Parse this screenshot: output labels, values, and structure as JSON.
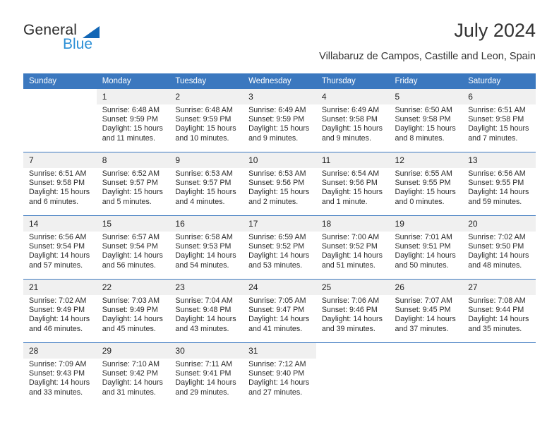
{
  "branding": {
    "name_part1": "General",
    "name_part2": "Blue",
    "triangle_color": "#1266b5",
    "blue_text_color": "#2b8fd6"
  },
  "header": {
    "title": "July 2024",
    "subtitle": "Villabaruz de Campos, Castille and Leon, Spain"
  },
  "theme": {
    "header_blue": "#3b78bf",
    "daynum_background": "#f0f0f0",
    "text_color": "#2a2a2a"
  },
  "columns": [
    "Sunday",
    "Monday",
    "Tuesday",
    "Wednesday",
    "Thursday",
    "Friday",
    "Saturday"
  ],
  "weeks": [
    [
      {
        "day": "",
        "sunrise": "",
        "sunset": "",
        "daylight_line1": "",
        "daylight_line2": ""
      },
      {
        "day": "1",
        "sunrise": "Sunrise: 6:48 AM",
        "sunset": "Sunset: 9:59 PM",
        "daylight_line1": "Daylight: 15 hours",
        "daylight_line2": "and 11 minutes."
      },
      {
        "day": "2",
        "sunrise": "Sunrise: 6:48 AM",
        "sunset": "Sunset: 9:59 PM",
        "daylight_line1": "Daylight: 15 hours",
        "daylight_line2": "and 10 minutes."
      },
      {
        "day": "3",
        "sunrise": "Sunrise: 6:49 AM",
        "sunset": "Sunset: 9:59 PM",
        "daylight_line1": "Daylight: 15 hours",
        "daylight_line2": "and 9 minutes."
      },
      {
        "day": "4",
        "sunrise": "Sunrise: 6:49 AM",
        "sunset": "Sunset: 9:58 PM",
        "daylight_line1": "Daylight: 15 hours",
        "daylight_line2": "and 9 minutes."
      },
      {
        "day": "5",
        "sunrise": "Sunrise: 6:50 AM",
        "sunset": "Sunset: 9:58 PM",
        "daylight_line1": "Daylight: 15 hours",
        "daylight_line2": "and 8 minutes."
      },
      {
        "day": "6",
        "sunrise": "Sunrise: 6:51 AM",
        "sunset": "Sunset: 9:58 PM",
        "daylight_line1": "Daylight: 15 hours",
        "daylight_line2": "and 7 minutes."
      }
    ],
    [
      {
        "day": "7",
        "sunrise": "Sunrise: 6:51 AM",
        "sunset": "Sunset: 9:58 PM",
        "daylight_line1": "Daylight: 15 hours",
        "daylight_line2": "and 6 minutes."
      },
      {
        "day": "8",
        "sunrise": "Sunrise: 6:52 AM",
        "sunset": "Sunset: 9:57 PM",
        "daylight_line1": "Daylight: 15 hours",
        "daylight_line2": "and 5 minutes."
      },
      {
        "day": "9",
        "sunrise": "Sunrise: 6:53 AM",
        "sunset": "Sunset: 9:57 PM",
        "daylight_line1": "Daylight: 15 hours",
        "daylight_line2": "and 4 minutes."
      },
      {
        "day": "10",
        "sunrise": "Sunrise: 6:53 AM",
        "sunset": "Sunset: 9:56 PM",
        "daylight_line1": "Daylight: 15 hours",
        "daylight_line2": "and 2 minutes."
      },
      {
        "day": "11",
        "sunrise": "Sunrise: 6:54 AM",
        "sunset": "Sunset: 9:56 PM",
        "daylight_line1": "Daylight: 15 hours",
        "daylight_line2": "and 1 minute."
      },
      {
        "day": "12",
        "sunrise": "Sunrise: 6:55 AM",
        "sunset": "Sunset: 9:55 PM",
        "daylight_line1": "Daylight: 15 hours",
        "daylight_line2": "and 0 minutes."
      },
      {
        "day": "13",
        "sunrise": "Sunrise: 6:56 AM",
        "sunset": "Sunset: 9:55 PM",
        "daylight_line1": "Daylight: 14 hours",
        "daylight_line2": "and 59 minutes."
      }
    ],
    [
      {
        "day": "14",
        "sunrise": "Sunrise: 6:56 AM",
        "sunset": "Sunset: 9:54 PM",
        "daylight_line1": "Daylight: 14 hours",
        "daylight_line2": "and 57 minutes."
      },
      {
        "day": "15",
        "sunrise": "Sunrise: 6:57 AM",
        "sunset": "Sunset: 9:54 PM",
        "daylight_line1": "Daylight: 14 hours",
        "daylight_line2": "and 56 minutes."
      },
      {
        "day": "16",
        "sunrise": "Sunrise: 6:58 AM",
        "sunset": "Sunset: 9:53 PM",
        "daylight_line1": "Daylight: 14 hours",
        "daylight_line2": "and 54 minutes."
      },
      {
        "day": "17",
        "sunrise": "Sunrise: 6:59 AM",
        "sunset": "Sunset: 9:52 PM",
        "daylight_line1": "Daylight: 14 hours",
        "daylight_line2": "and 53 minutes."
      },
      {
        "day": "18",
        "sunrise": "Sunrise: 7:00 AM",
        "sunset": "Sunset: 9:52 PM",
        "daylight_line1": "Daylight: 14 hours",
        "daylight_line2": "and 51 minutes."
      },
      {
        "day": "19",
        "sunrise": "Sunrise: 7:01 AM",
        "sunset": "Sunset: 9:51 PM",
        "daylight_line1": "Daylight: 14 hours",
        "daylight_line2": "and 50 minutes."
      },
      {
        "day": "20",
        "sunrise": "Sunrise: 7:02 AM",
        "sunset": "Sunset: 9:50 PM",
        "daylight_line1": "Daylight: 14 hours",
        "daylight_line2": "and 48 minutes."
      }
    ],
    [
      {
        "day": "21",
        "sunrise": "Sunrise: 7:02 AM",
        "sunset": "Sunset: 9:49 PM",
        "daylight_line1": "Daylight: 14 hours",
        "daylight_line2": "and 46 minutes."
      },
      {
        "day": "22",
        "sunrise": "Sunrise: 7:03 AM",
        "sunset": "Sunset: 9:49 PM",
        "daylight_line1": "Daylight: 14 hours",
        "daylight_line2": "and 45 minutes."
      },
      {
        "day": "23",
        "sunrise": "Sunrise: 7:04 AM",
        "sunset": "Sunset: 9:48 PM",
        "daylight_line1": "Daylight: 14 hours",
        "daylight_line2": "and 43 minutes."
      },
      {
        "day": "24",
        "sunrise": "Sunrise: 7:05 AM",
        "sunset": "Sunset: 9:47 PM",
        "daylight_line1": "Daylight: 14 hours",
        "daylight_line2": "and 41 minutes."
      },
      {
        "day": "25",
        "sunrise": "Sunrise: 7:06 AM",
        "sunset": "Sunset: 9:46 PM",
        "daylight_line1": "Daylight: 14 hours",
        "daylight_line2": "and 39 minutes."
      },
      {
        "day": "26",
        "sunrise": "Sunrise: 7:07 AM",
        "sunset": "Sunset: 9:45 PM",
        "daylight_line1": "Daylight: 14 hours",
        "daylight_line2": "and 37 minutes."
      },
      {
        "day": "27",
        "sunrise": "Sunrise: 7:08 AM",
        "sunset": "Sunset: 9:44 PM",
        "daylight_line1": "Daylight: 14 hours",
        "daylight_line2": "and 35 minutes."
      }
    ],
    [
      {
        "day": "28",
        "sunrise": "Sunrise: 7:09 AM",
        "sunset": "Sunset: 9:43 PM",
        "daylight_line1": "Daylight: 14 hours",
        "daylight_line2": "and 33 minutes."
      },
      {
        "day": "29",
        "sunrise": "Sunrise: 7:10 AM",
        "sunset": "Sunset: 9:42 PM",
        "daylight_line1": "Daylight: 14 hours",
        "daylight_line2": "and 31 minutes."
      },
      {
        "day": "30",
        "sunrise": "Sunrise: 7:11 AM",
        "sunset": "Sunset: 9:41 PM",
        "daylight_line1": "Daylight: 14 hours",
        "daylight_line2": "and 29 minutes."
      },
      {
        "day": "31",
        "sunrise": "Sunrise: 7:12 AM",
        "sunset": "Sunset: 9:40 PM",
        "daylight_line1": "Daylight: 14 hours",
        "daylight_line2": "and 27 minutes."
      },
      {
        "day": "",
        "sunrise": "",
        "sunset": "",
        "daylight_line1": "",
        "daylight_line2": ""
      },
      {
        "day": "",
        "sunrise": "",
        "sunset": "",
        "daylight_line1": "",
        "daylight_line2": ""
      },
      {
        "day": "",
        "sunrise": "",
        "sunset": "",
        "daylight_line1": "",
        "daylight_line2": ""
      }
    ]
  ]
}
